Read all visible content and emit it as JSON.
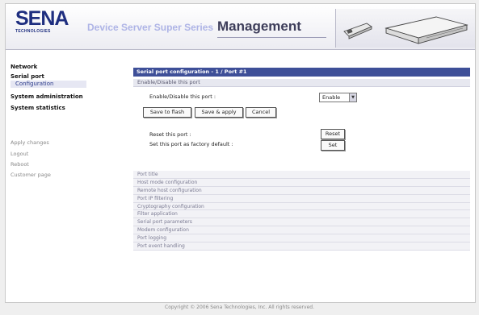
{
  "header": {
    "logo_main": "SENA",
    "logo_sub": "TECHNOLOGIES",
    "product_name": "Device Server Super Series",
    "title": "Management"
  },
  "sidebar": {
    "network": "Network",
    "serial_port": "Serial port",
    "configuration": "Configuration",
    "system_administration": "System administration",
    "system_statistics": "System statistics",
    "apply_changes": "Apply changes",
    "logout": "Logout",
    "reboot": "Reboot",
    "customer_page": "Customer page"
  },
  "content": {
    "title": "Serial port configuration - 1 / Port #1",
    "section_enable": "Enable/Disable this port",
    "enable_label": "Enable/Disable this port :",
    "enable_value": "Enable",
    "save_to_flash": "Save to flash",
    "save_apply": "Save & apply",
    "cancel": "Cancel",
    "reset_label": "Reset this port :",
    "reset_button": "Reset",
    "factory_label": "Set this port as factory default :",
    "set_button": "Set",
    "collapsed_sections": [
      "Port title",
      "Host mode configuration",
      "Remote host configuration",
      "Port IP filtering",
      "Cryptography configuration",
      "Filter application",
      "Serial port parameters",
      "Modem configuration",
      "Port logging",
      "Port event handling"
    ]
  },
  "footer": "Copyright © 2006 Sena Technologies, Inc. All rights reserved."
}
